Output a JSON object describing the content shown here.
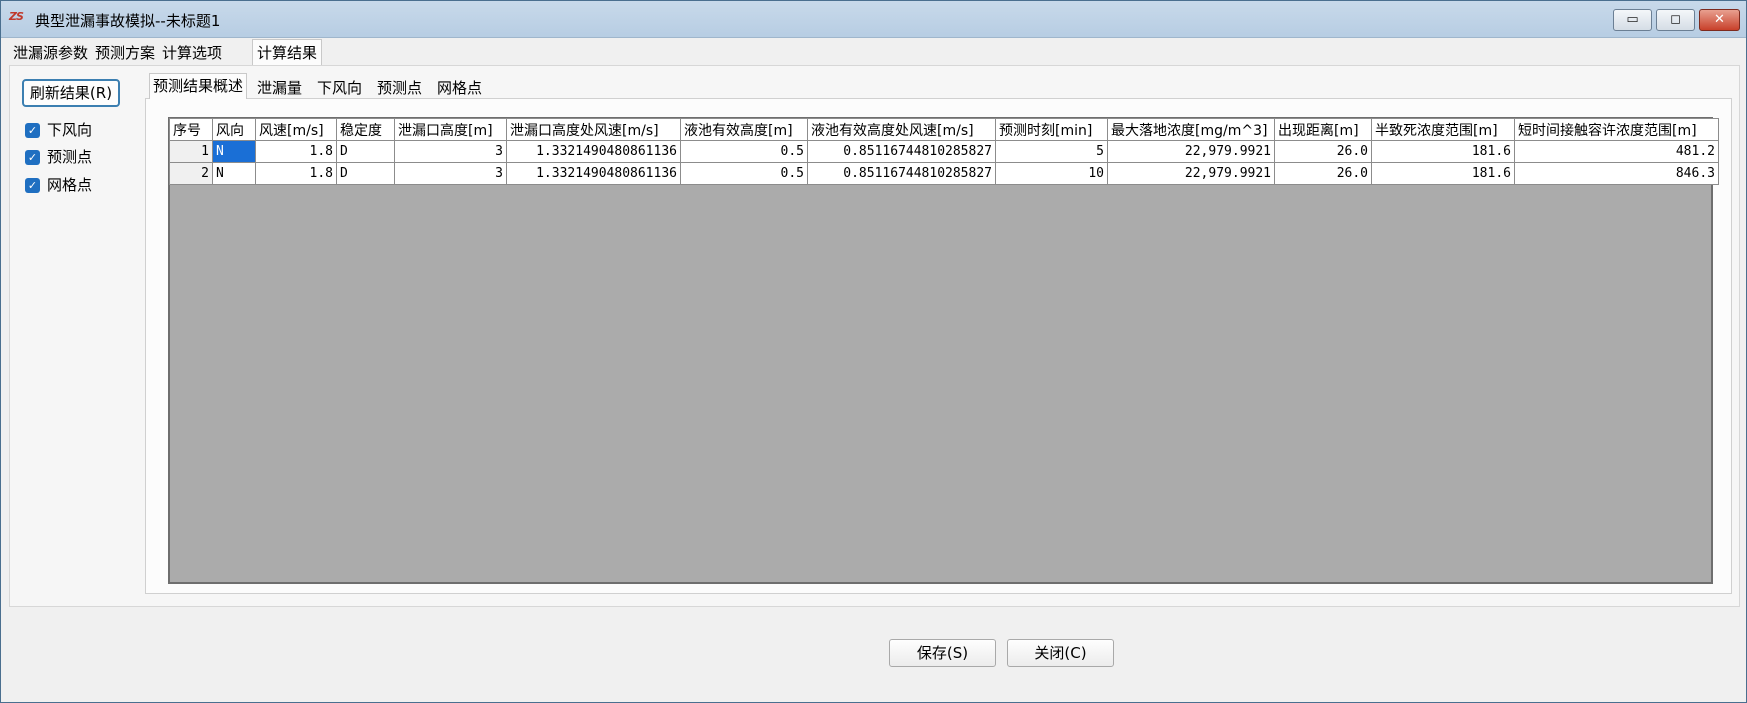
{
  "window": {
    "title": "典型泄漏事故模拟--未标题1",
    "app_icon_text": "ZS",
    "min_glyph": "▭",
    "max_glyph": "◻",
    "close_glyph": "✕"
  },
  "main_tabs": [
    {
      "label": "泄漏源参数"
    },
    {
      "label": "预测方案"
    },
    {
      "label": "计算选项"
    },
    {
      "label": "计算结果",
      "active": true
    }
  ],
  "left_panel": {
    "refresh_label": "刷新结果(R)",
    "checkboxes": [
      {
        "label": "下风向",
        "checked": true
      },
      {
        "label": "预测点",
        "checked": true
      },
      {
        "label": "网格点",
        "checked": true
      }
    ],
    "check_glyph": "✓"
  },
  "sub_tabs": [
    {
      "label": "预测结果概述",
      "active": true
    },
    {
      "label": "泄漏量"
    },
    {
      "label": "下风向"
    },
    {
      "label": "预测点"
    },
    {
      "label": "网格点"
    }
  ],
  "table": {
    "headers": [
      "序号",
      "风向",
      "风速[m/s]",
      "稳定度",
      "泄漏口高度[m]",
      "泄漏口高度处风速[m/s]",
      "液池有效高度[m]",
      "液池有效高度处风速[m/s]",
      "预测时刻[min]",
      "最大落地浓度[mg/m^3]",
      "出现距离[m]",
      "半致死浓度范围[m]",
      "短时间接触容许浓度范围[m]"
    ],
    "rows": [
      [
        "1",
        "N",
        "1.8",
        "D",
        "3",
        "1.3321490480861136",
        "0.5",
        "0.85116744810285827",
        "5",
        "22,979.9921",
        "26.0",
        "181.6",
        "481.2"
      ],
      [
        "2",
        "N",
        "1.8",
        "D",
        "3",
        "1.3321490480861136",
        "0.5",
        "0.85116744810285827",
        "10",
        "22,979.9921",
        "26.0",
        "181.6",
        "846.3"
      ]
    ]
  },
  "buttons": {
    "save_label": "保存(S)",
    "close_label": "关闭(C)"
  }
}
